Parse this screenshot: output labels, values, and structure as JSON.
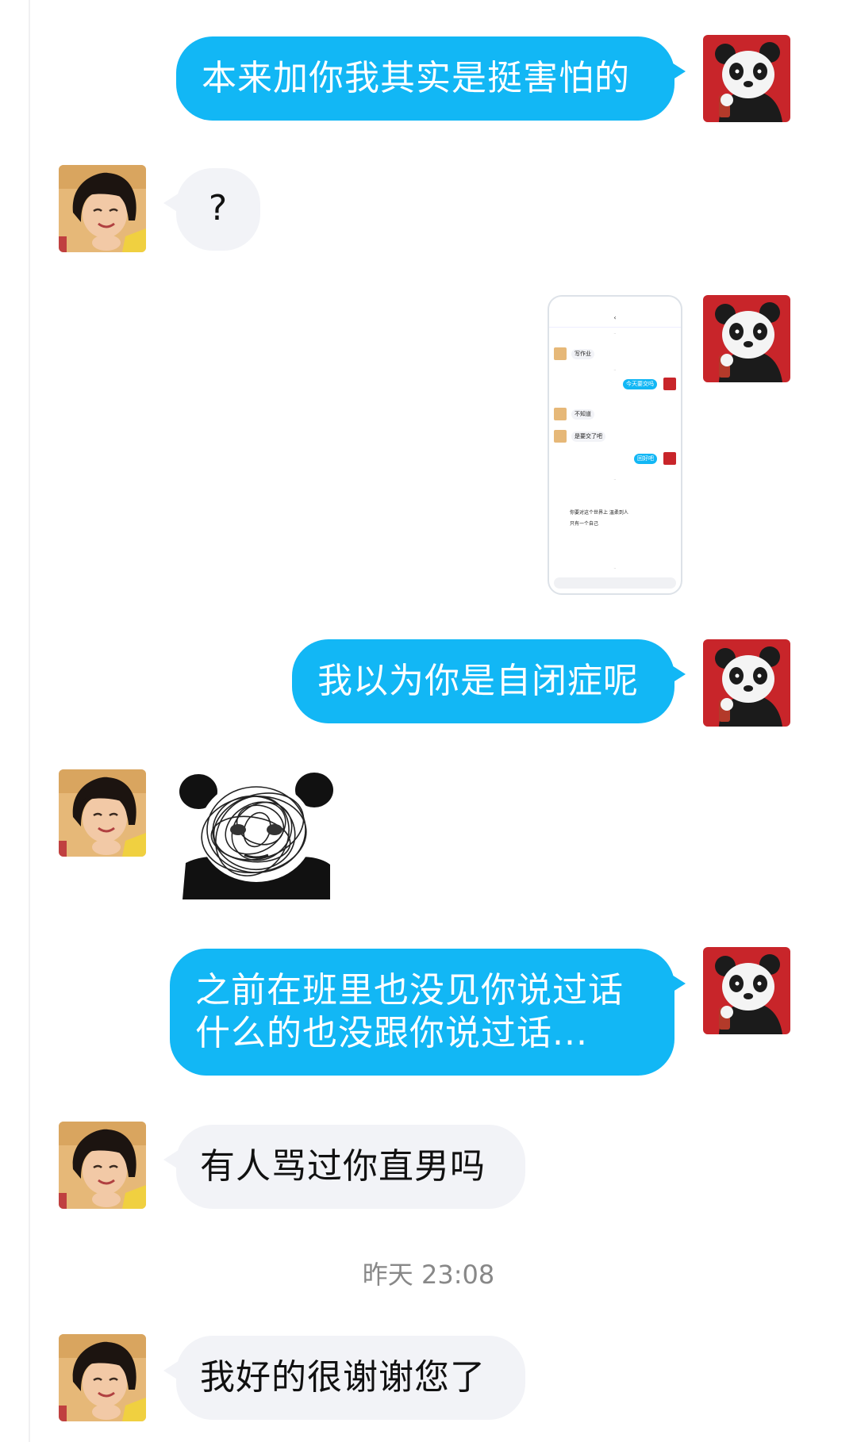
{
  "messages": [
    {
      "side": "out",
      "text": "本来加你我其实是挺害怕的"
    },
    {
      "side": "in",
      "text": "?"
    },
    {
      "side": "out",
      "type": "image",
      "content": "chat-screenshot"
    },
    {
      "side": "out",
      "text": "我以为你是自闭症呢"
    },
    {
      "side": "in",
      "type": "sticker",
      "content": "scribbled-panda-sticker"
    },
    {
      "side": "out",
      "text": "之前在班里也没见你说过话\n什么的也没跟你说过话..."
    },
    {
      "side": "in",
      "text": "有人骂过你直男吗"
    },
    {
      "side": "in",
      "text": "我好的很谢谢您了"
    }
  ],
  "timestamp": "昨天 23:08",
  "embedded_screenshot": {
    "messages": [
      "写作业",
      "今天要交吗",
      "不知道",
      "是要交了吧",
      "回好吧",
      "你要对这个世界上 温柔到人",
      "只有一个自己"
    ]
  },
  "colors": {
    "outgoing_bubble": "#12b7f5",
    "incoming_bubble": "#f2f3f7",
    "background": "#ffffff"
  }
}
